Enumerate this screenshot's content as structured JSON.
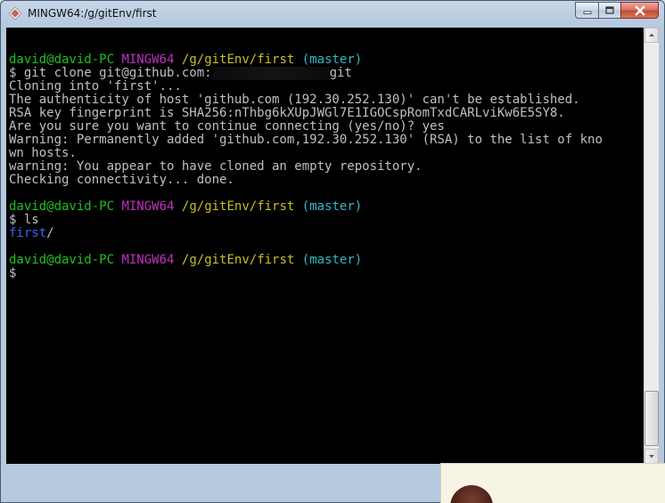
{
  "window": {
    "title": "MINGW64:/g/gitEnv/first",
    "icon": "git-bash-icon",
    "controls": {
      "minimize_icon": "minimize-icon",
      "maximize_icon": "maximize-icon",
      "close_icon": "close-icon"
    }
  },
  "terminal": {
    "lines": [
      {
        "kind": "blank",
        "text": ""
      },
      {
        "kind": "prompt",
        "user": "david@david-PC",
        "shell": "MINGW64",
        "path": "/g/gitEnv/first",
        "branch": "(master)"
      },
      {
        "kind": "command-redacted",
        "before": "$ git clone git@github.com:",
        "after": "git"
      },
      {
        "kind": "text",
        "text": "Cloning into 'first'..."
      },
      {
        "kind": "text",
        "text": "The authenticity of host 'github.com (192.30.252.130)' can't be established."
      },
      {
        "kind": "text",
        "text": "RSA key fingerprint is SHA256:nThbg6kXUpJWGl7E1IGOCspRomTxdCARLviKw6E5SY8."
      },
      {
        "kind": "text",
        "text": "Are you sure you want to continue connecting (yes/no)? yes"
      },
      {
        "kind": "text",
        "text": "Warning: Permanently added 'github.com,192.30.252.130' (RSA) to the list of kno"
      },
      {
        "kind": "text",
        "text": "wn hosts."
      },
      {
        "kind": "text",
        "text": "warning: You appear to have cloned an empty repository."
      },
      {
        "kind": "text",
        "text": "Checking connectivity... done."
      },
      {
        "kind": "blank",
        "text": ""
      },
      {
        "kind": "prompt",
        "user": "david@david-PC",
        "shell": "MINGW64",
        "path": "/g/gitEnv/first",
        "branch": "(master)"
      },
      {
        "kind": "text",
        "text": "$ ls"
      },
      {
        "kind": "dir",
        "name": "first",
        "suffix": "/"
      },
      {
        "kind": "blank",
        "text": ""
      },
      {
        "kind": "prompt",
        "user": "david@david-PC",
        "shell": "MINGW64",
        "path": "/g/gitEnv/first",
        "branch": "(master)"
      },
      {
        "kind": "input",
        "text": "$"
      }
    ]
  },
  "colors": {
    "user": "#20c020",
    "shell": "#c030c0",
    "path": "#c8c020",
    "branch": "#30b8c8",
    "directory": "#4060ff",
    "text": "#c0c0c0"
  }
}
